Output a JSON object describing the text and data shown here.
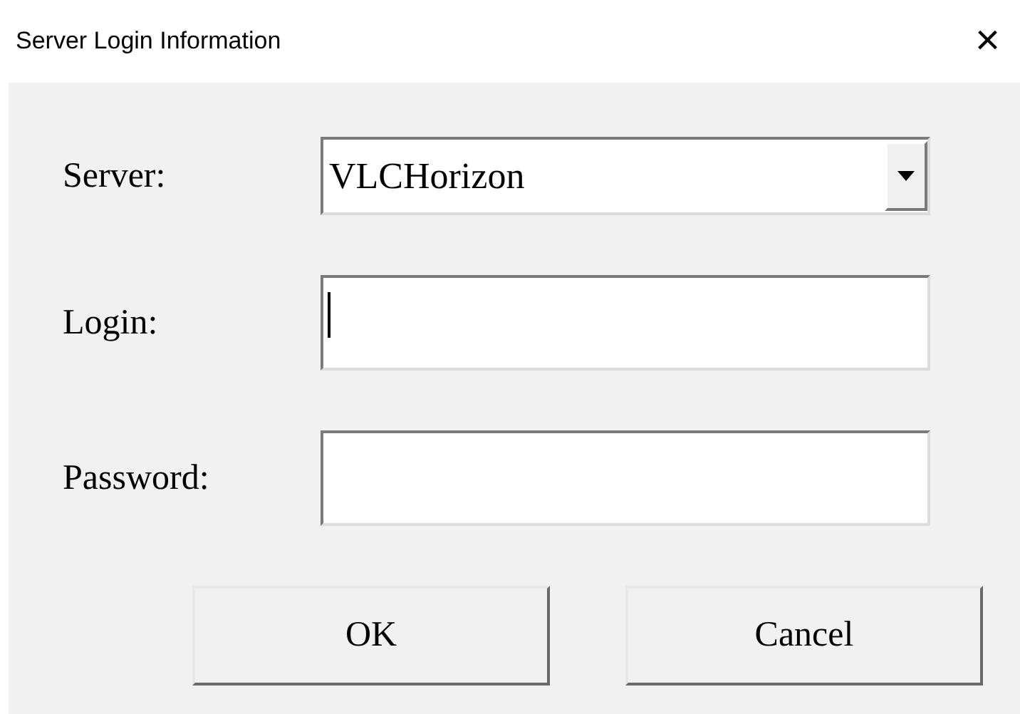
{
  "window": {
    "title": "Server Login Information",
    "close": "×"
  },
  "fields": [
    {
      "label": "Server:",
      "kind": "combo",
      "value": "VLCHorizon",
      "focused": false
    },
    {
      "label": "Login:",
      "kind": "text",
      "focused": true
    },
    {
      "label": "Password:",
      "kind": "password",
      "focused": false
    }
  ],
  "buttons": [
    "OK",
    "Cancel"
  ]
}
